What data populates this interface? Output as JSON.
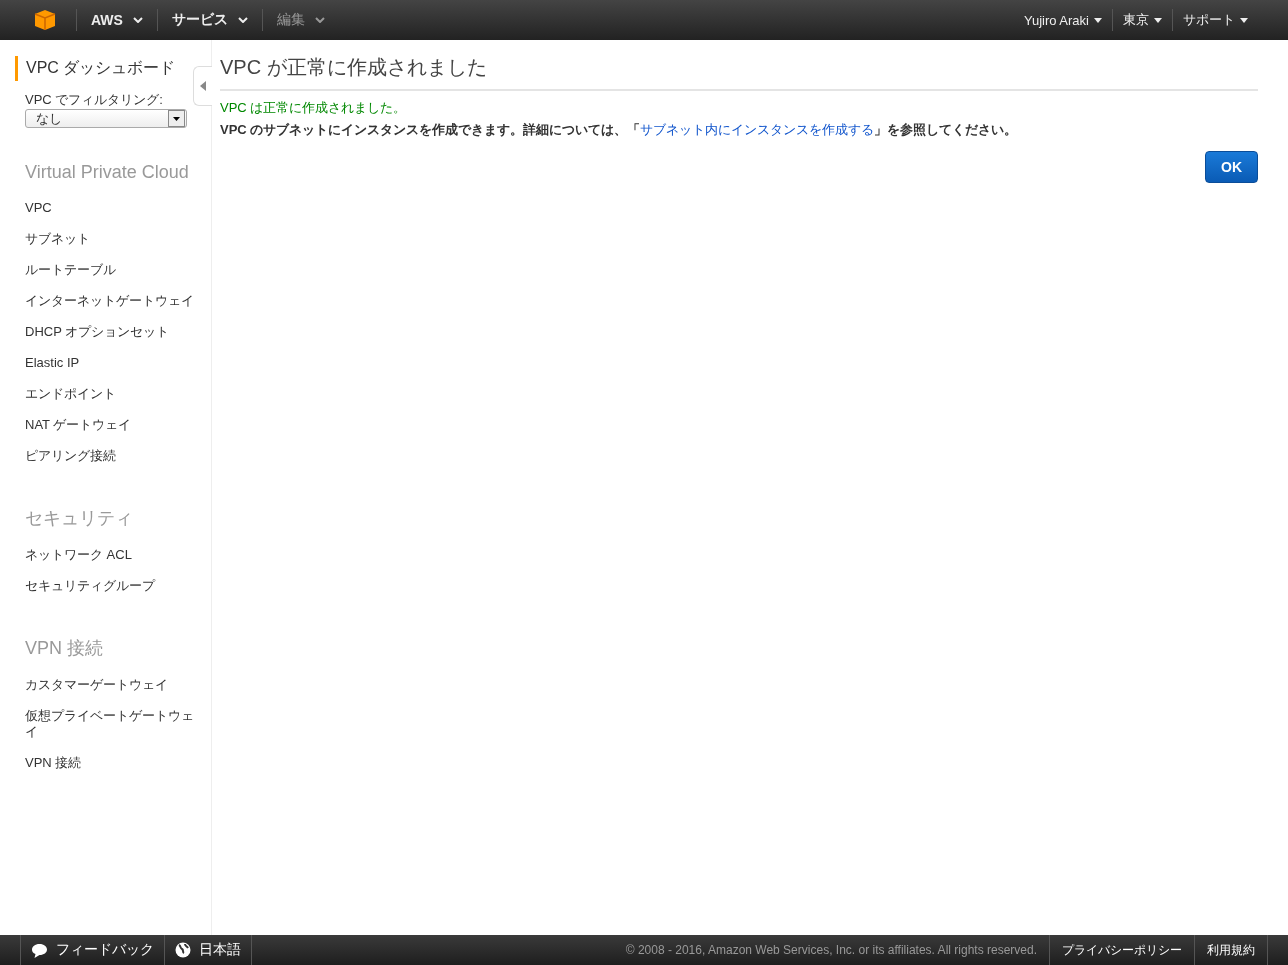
{
  "top_nav": {
    "left": [
      {
        "label": "AWS",
        "disabled": false
      },
      {
        "label": "サービス",
        "disabled": false
      },
      {
        "label": "編集",
        "disabled": true
      }
    ],
    "right": [
      {
        "label": "Yujiro Araki"
      },
      {
        "label": "東京"
      },
      {
        "label": "サポート"
      }
    ]
  },
  "sidebar": {
    "dashboard": {
      "label": "VPC ダッシュボード",
      "selected": true
    },
    "filter": {
      "label": "VPC でフィルタリング:",
      "value": "なし"
    },
    "sections": [
      {
        "heading": "Virtual Private Cloud",
        "items": [
          "VPC",
          "サブネット",
          "ルートテーブル",
          "インターネットゲートウェイ",
          "DHCP オプションセット",
          "Elastic IP",
          "エンドポイント",
          "NAT ゲートウェイ",
          "ピアリング接続"
        ]
      },
      {
        "heading": "セキュリティ",
        "items": [
          "ネットワーク ACL",
          "セキュリティグループ"
        ]
      },
      {
        "heading": "VPN 接続",
        "items": [
          "カスタマーゲートウェイ",
          "仮想プライベートゲートウェイ",
          "VPN 接続"
        ]
      }
    ]
  },
  "main": {
    "title": "VPC が正常に作成されました",
    "success": "VPC は正常に作成されました。",
    "info": {
      "before": "VPC のサブネットにインスタンスを作成できます。詳細については、「",
      "link": "サブネット内にインスタンスを作成する",
      "after": "」を参照してください。"
    },
    "ok_button": "OK"
  },
  "footer": {
    "feedback": "フィードバック",
    "language": "日本語",
    "copyright": "© 2008 - 2016, Amazon Web Services, Inc. or its affiliates. All rights reserved.",
    "links": [
      "プライバシーポリシー",
      "利用規約"
    ]
  }
}
